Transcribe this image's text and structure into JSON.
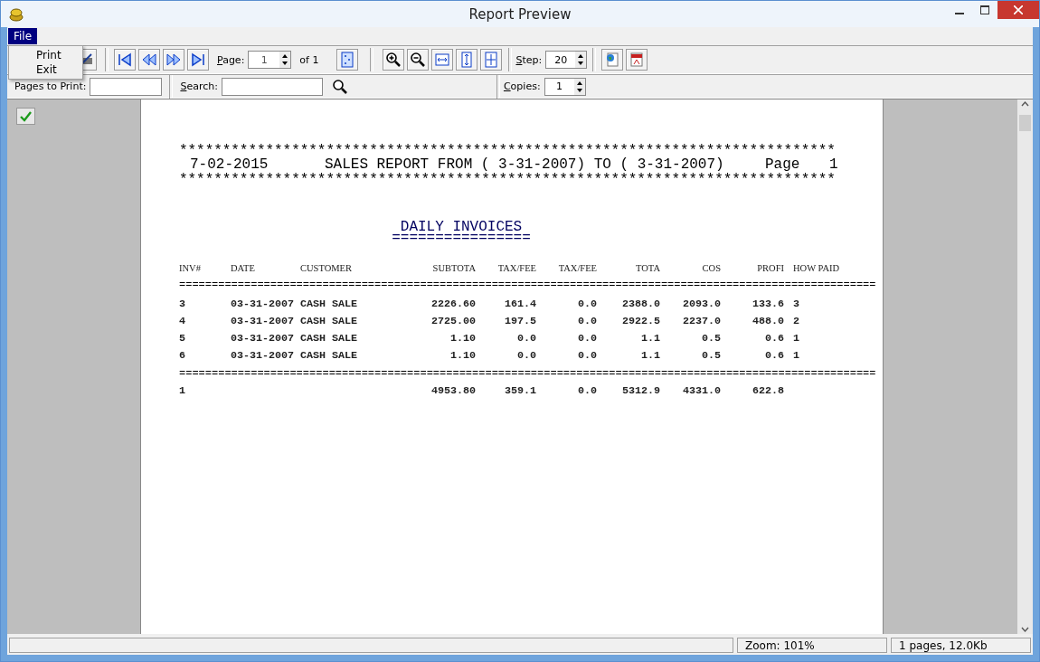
{
  "window": {
    "title": "Report Preview"
  },
  "menu": [
    {
      "label": "File",
      "selected": true
    }
  ],
  "file_menu": {
    "items": [
      {
        "label": "Print"
      },
      {
        "label": "Exit"
      }
    ]
  },
  "toolbar": {
    "page_label": "Page:",
    "page_value": "1",
    "page_of": "of 1",
    "step_label": "Step:",
    "step_value": "20"
  },
  "toolbar2": {
    "pages_label": "Pages to Print:",
    "search_label": "Search:",
    "copies_label": "Copies:",
    "copies_value": "1"
  },
  "report": {
    "stars": "****************************************************************************",
    "date": "7-02-2015",
    "title": "SALES REPORT FROM ( 3-31-2007) TO ( 3-31-2007)",
    "page_label": "Page",
    "page_number": "1",
    "heading": "DAILY INVOICES",
    "heading_rule": "================",
    "rule": "===========================================================================================================",
    "columns": [
      "INV#",
      "DATE",
      "CUSTOMER",
      "SUBTOTA",
      "TAX/FEE",
      "TAX/FEE",
      "TOTA",
      "COS",
      "PROFI",
      "HOW PAID"
    ],
    "rows": [
      [
        "3",
        "03-31-2007",
        "CASH SALE",
        "2226.60",
        "161.4",
        "0.0",
        "2388.0",
        "2093.0",
        "133.6",
        "3"
      ],
      [
        "4",
        "03-31-2007",
        "CASH SALE",
        "2725.00",
        "197.5",
        "0.0",
        "2922.5",
        "2237.0",
        "488.0",
        "2"
      ],
      [
        "5",
        "03-31-2007",
        "CASH SALE",
        "1.10",
        "0.0",
        "0.0",
        "1.1",
        "0.5",
        "0.6",
        "1"
      ],
      [
        "6",
        "03-31-2007",
        "CASH SALE",
        "1.10",
        "0.0",
        "0.0",
        "1.1",
        "0.5",
        "0.6",
        "1"
      ]
    ],
    "totals": {
      "inv": "1",
      "subtotal": "4953.80",
      "tax_fee": "359.1",
      "tax_fee_2": "0.0",
      "total": "5312.9",
      "cost": "4331.0",
      "profit": "622.8"
    }
  },
  "status_bar": {
    "zoom": "Zoom: 101%",
    "size": "1 pages, 12.0Kb"
  }
}
